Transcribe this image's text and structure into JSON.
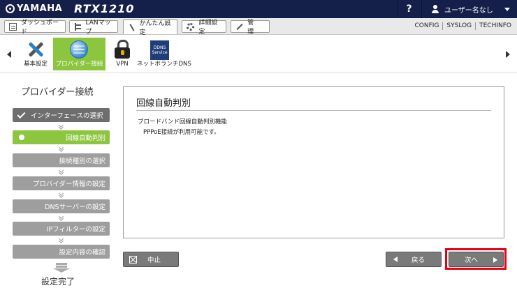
{
  "header": {
    "brand": "YAMAHA",
    "model": "RTX1210",
    "help_label": "?",
    "user_label": "ユーザー名なし"
  },
  "nav": {
    "tabs": [
      {
        "label": "ダッシュボード",
        "icon": "dashboard-icon"
      },
      {
        "label": "LANマップ",
        "icon": "lan-map-icon"
      },
      {
        "label": "かんたん設定",
        "icon": "wizard-icon",
        "active": true
      },
      {
        "label": "詳細設定",
        "icon": "gear-icon"
      },
      {
        "label": "管　理",
        "icon": "tools-icon"
      }
    ],
    "links": [
      "CONFIG",
      "SYSLOG",
      "TECHINFO"
    ]
  },
  "quickbar": {
    "items": [
      {
        "label": "基本設定",
        "icon": "tools-icon"
      },
      {
        "label": "プロバイダー接続",
        "icon": "globe-icon",
        "active": true
      },
      {
        "label": "VPN",
        "icon": "lock-icon"
      },
      {
        "label": "ネットボランチDNS",
        "icon": "ddns-icon",
        "badge_text": "DDNS Service"
      }
    ]
  },
  "wizard": {
    "title": "プロバイダー接続",
    "steps": [
      {
        "label": "インターフェースの選択",
        "state": "done"
      },
      {
        "label": "回線自動判別",
        "state": "current"
      },
      {
        "label": "接続種別の選択",
        "state": "pending"
      },
      {
        "label": "プロバイダー情報の設定",
        "state": "pending"
      },
      {
        "label": "DNSサーバーの設定",
        "state": "pending"
      },
      {
        "label": "IPフィルターの設定",
        "state": "pending"
      },
      {
        "label": "設定内容の確認",
        "state": "pending"
      }
    ],
    "complete_label": "設定完了"
  },
  "panel": {
    "title": "回線自動判別",
    "line1": "ブロードバンド回線自動判別機能",
    "line2": "PPPoE接続が利用可能です。"
  },
  "buttons": {
    "cancel": "中止",
    "back": "戻る",
    "next": "次へ"
  },
  "colors": {
    "header_bg": "#14204a",
    "accent_green": "#8cc63f",
    "highlight_red": "#e60012"
  }
}
